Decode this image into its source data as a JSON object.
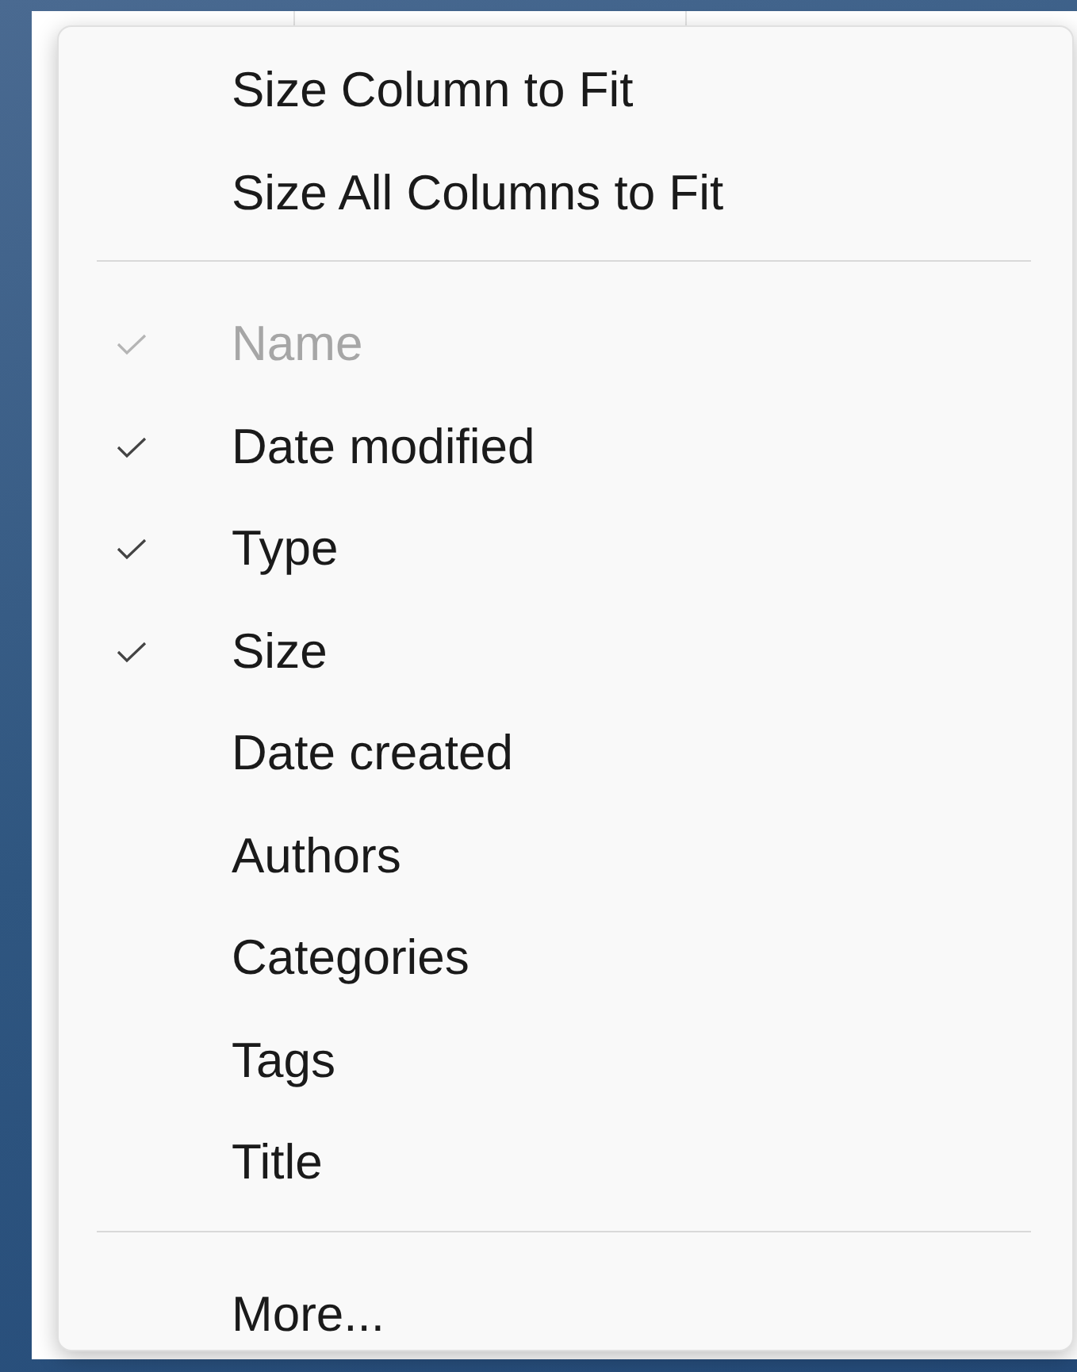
{
  "context_menu": {
    "sections": [
      {
        "items": [
          {
            "label": "Size Column to Fit",
            "kind": "command"
          },
          {
            "label": "Size All Columns to Fit",
            "kind": "command"
          }
        ]
      },
      {
        "items": [
          {
            "label": "Name",
            "kind": "toggle",
            "checked": true,
            "disabled": true
          },
          {
            "label": "Date modified",
            "kind": "toggle",
            "checked": true,
            "disabled": false
          },
          {
            "label": "Type",
            "kind": "toggle",
            "checked": true,
            "disabled": false
          },
          {
            "label": "Size",
            "kind": "toggle",
            "checked": true,
            "disabled": false
          },
          {
            "label": "Date created",
            "kind": "toggle",
            "checked": false,
            "disabled": false
          },
          {
            "label": "Authors",
            "kind": "toggle",
            "checked": false,
            "disabled": false
          },
          {
            "label": "Categories",
            "kind": "toggle",
            "checked": false,
            "disabled": false
          },
          {
            "label": "Tags",
            "kind": "toggle",
            "checked": false,
            "disabled": false
          },
          {
            "label": "Title",
            "kind": "toggle",
            "checked": false,
            "disabled": false
          }
        ]
      },
      {
        "items": [
          {
            "label": "More...",
            "kind": "command"
          }
        ]
      }
    ]
  }
}
